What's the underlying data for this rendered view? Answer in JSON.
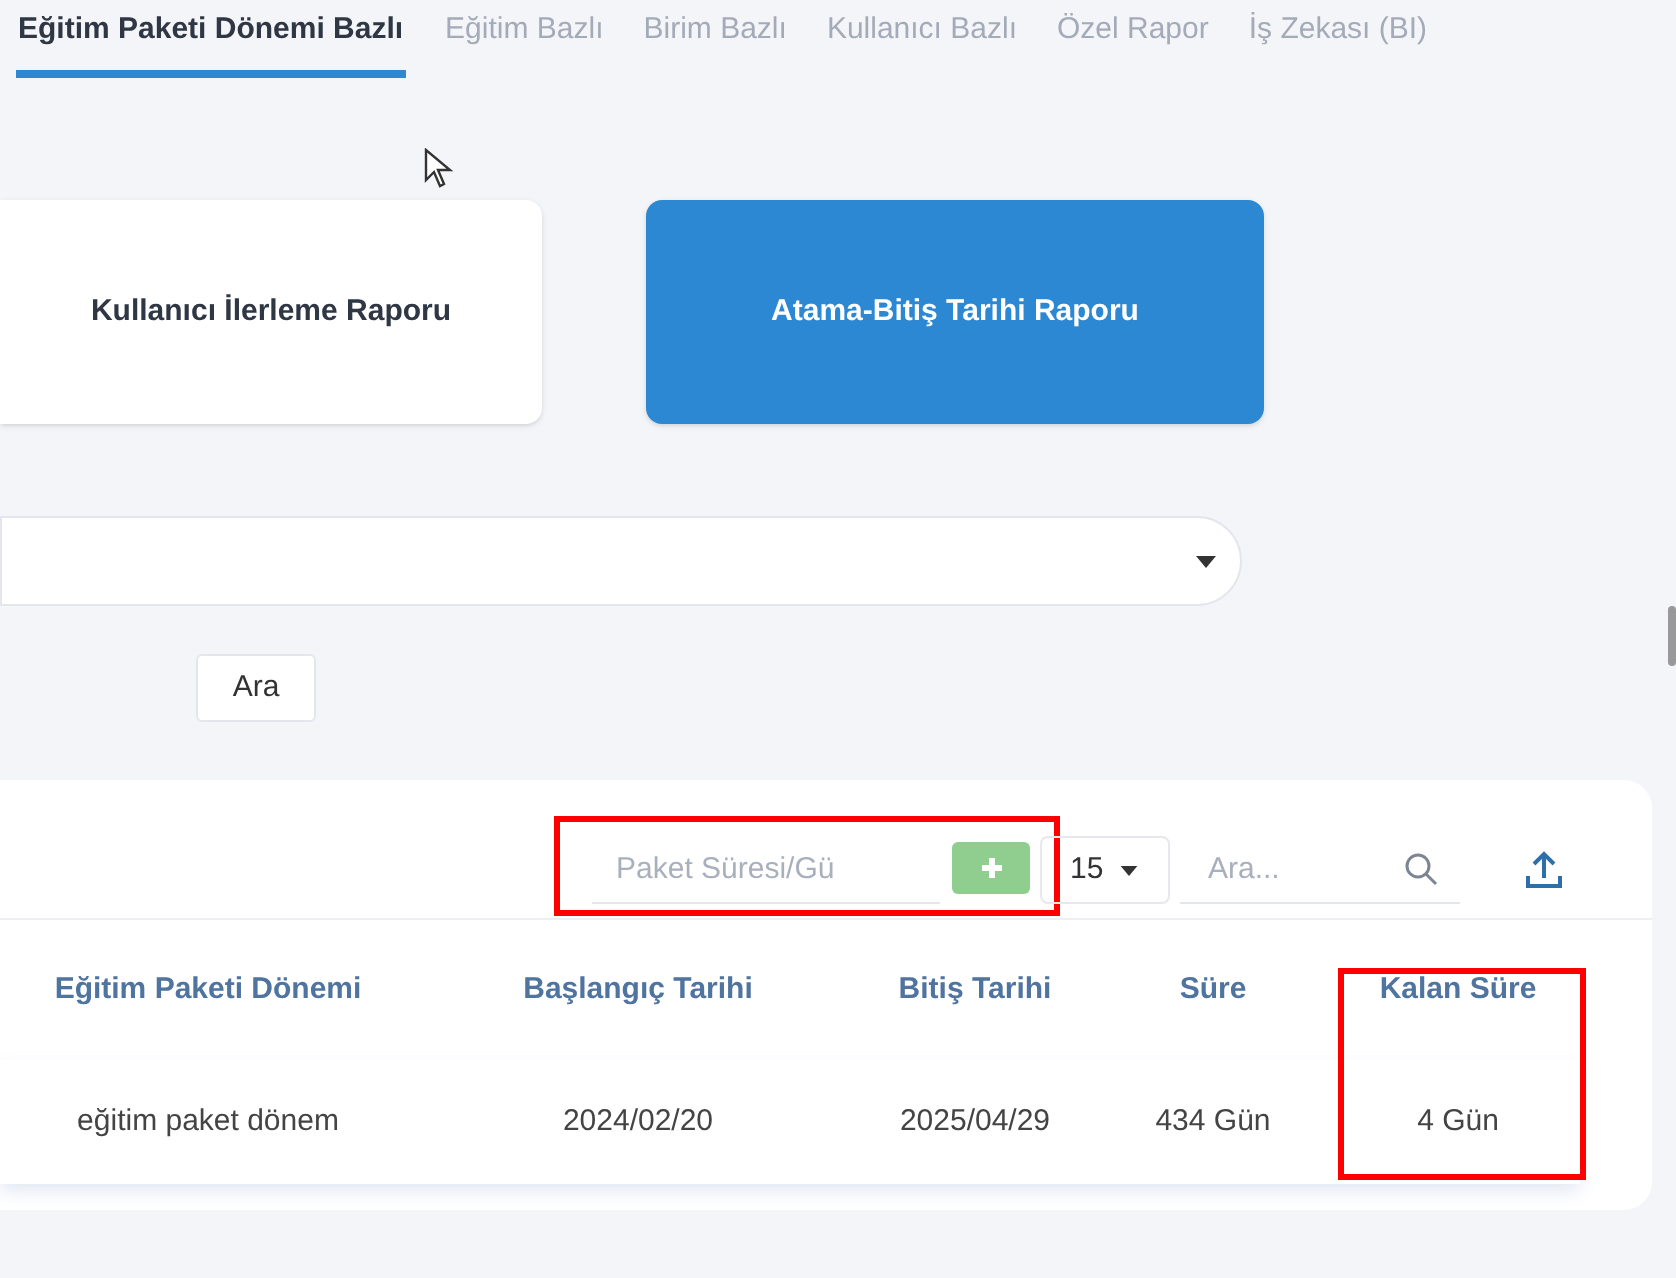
{
  "tabs": [
    {
      "label": "Eğitim Paketi Dönemi Bazlı",
      "selected": true
    },
    {
      "label": "Eğitim Bazlı",
      "selected": false
    },
    {
      "label": "Birim Bazlı",
      "selected": false
    },
    {
      "label": "Kullanıcı Bazlı",
      "selected": false
    },
    {
      "label": "Özel Rapor",
      "selected": false
    },
    {
      "label": "İş Zekası (BI)",
      "selected": false
    }
  ],
  "report_cards": [
    {
      "label": "Kullanıcı İlerleme Raporu",
      "selected": false
    },
    {
      "label": "Atama-Bitiş Tarihi Raporu",
      "selected": true
    }
  ],
  "search_button": "Ara",
  "toolbar": {
    "duration_field": {
      "placeholder": "Paket Süresi/Gü",
      "highlighted": true
    },
    "page_size": "15",
    "search": {
      "placeholder": "Ara..."
    }
  },
  "table": {
    "columns": [
      {
        "label": "Eğitim Paketi Dönemi",
        "highlighted": false
      },
      {
        "label": "Başlangıç Tarihi",
        "highlighted": false
      },
      {
        "label": "Bitiş Tarihi",
        "highlighted": false
      },
      {
        "label": "Süre",
        "highlighted": false
      },
      {
        "label": "Kalan Süre",
        "highlighted": true
      }
    ],
    "rows": [
      [
        "eğitim paket dönem",
        "2024/02/20",
        "2025/04/29",
        "434 Gün",
        "4 Gün"
      ]
    ]
  }
}
